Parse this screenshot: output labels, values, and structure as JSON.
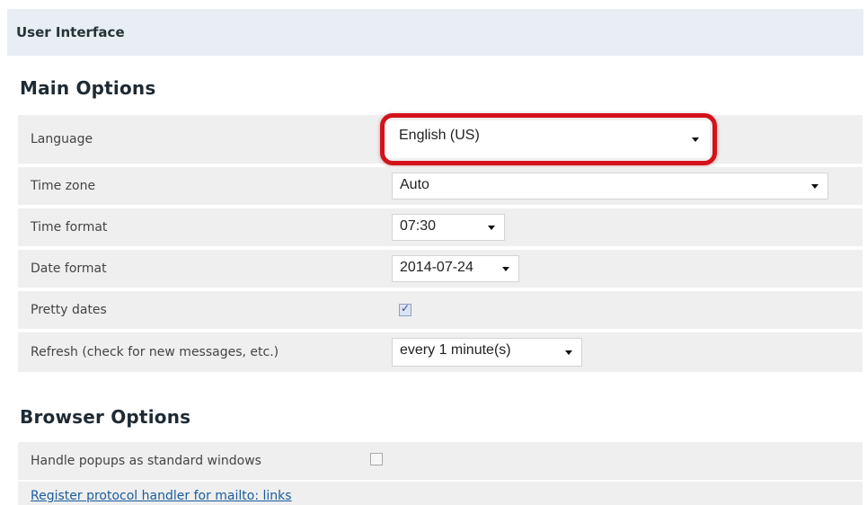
{
  "header": {
    "title": "User Interface"
  },
  "main_options": {
    "title": "Main Options",
    "rows": [
      {
        "label": "Language",
        "value": "English (US)"
      },
      {
        "label": "Time zone",
        "value": "Auto"
      },
      {
        "label": "Time format",
        "value": "07:30"
      },
      {
        "label": "Date format",
        "value": "2014-07-24"
      },
      {
        "label": "Pretty dates",
        "checked": true
      },
      {
        "label": "Refresh (check for new messages, etc.)",
        "value": "every 1 minute(s)"
      }
    ]
  },
  "browser_options": {
    "title": "Browser Options",
    "popups_label": "Handle popups as standard windows",
    "popups_checked": false,
    "protocol_link": "Register protocol handler for mailto: links"
  },
  "colors": {
    "header_bg": "#e8eef4",
    "row_bg": "#efefef",
    "highlight": "#d4121a",
    "link": "#1a5d9c"
  }
}
